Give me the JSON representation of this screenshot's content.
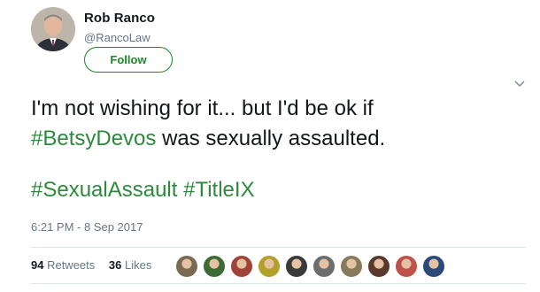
{
  "author": {
    "display_name": "Rob Ranco",
    "handle": "@RancoLaw",
    "follow_label": "Follow"
  },
  "tweet": {
    "line1": "I'm not wishing for it... but I'd be ok if",
    "hashtag1": "#BetsyDevos",
    "line2_rest": " was sexually assaulted.",
    "hashtag2": "#SexualAssault",
    "hashtag3": "#TitleIX",
    "timestamp": "6:21 PM - 8 Sep 2017"
  },
  "stats": {
    "retweets_count": "94",
    "retweets_label": " Retweets",
    "likes_count": "36",
    "likes_label": " Likes"
  },
  "likers": [
    {
      "icon": "liker-avatar",
      "color": "#7a6a52"
    },
    {
      "icon": "liker-avatar",
      "color": "#3d6b34"
    },
    {
      "icon": "liker-avatar",
      "color": "#a0443a"
    },
    {
      "icon": "liker-avatar",
      "color": "#b3a02a"
    },
    {
      "icon": "liker-avatar",
      "color": "#3a3a3a"
    },
    {
      "icon": "liker-avatar",
      "color": "#6d6d6d"
    },
    {
      "icon": "liker-avatar",
      "color": "#8a7a5c"
    },
    {
      "icon": "liker-avatar",
      "color": "#5a3a2a"
    },
    {
      "icon": "liker-avatar",
      "color": "#c0504a"
    },
    {
      "icon": "liker-avatar",
      "color": "#2a4a7a"
    }
  ],
  "colors": {
    "hashtag": "#2d8a3d",
    "follow": "#1a8a2a",
    "muted": "#657786"
  }
}
